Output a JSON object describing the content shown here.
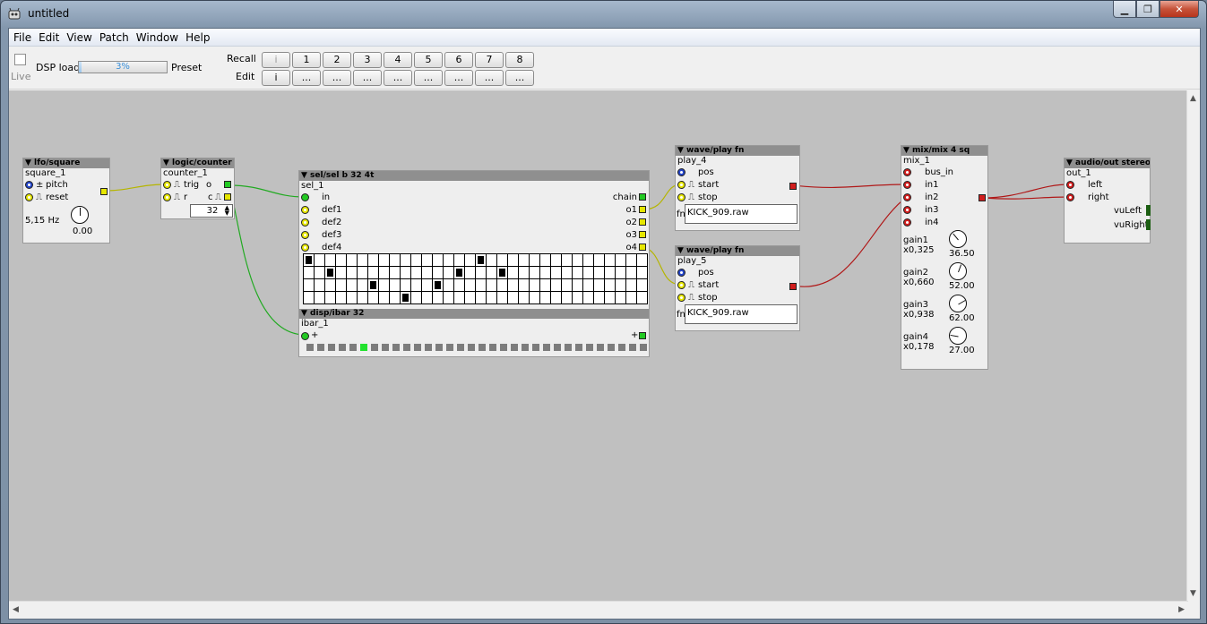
{
  "window": {
    "title": "untitled",
    "controls": {
      "minimize": "▁",
      "maximize": "❐",
      "close": "✕"
    }
  },
  "menu": {
    "items": [
      {
        "label": "File"
      },
      {
        "label": "Edit"
      },
      {
        "label": "View"
      },
      {
        "label": "Patch"
      },
      {
        "label": "Window"
      },
      {
        "label": "Help"
      }
    ]
  },
  "toolbar": {
    "live_label": "Live",
    "live_checked": false,
    "dsp_label": "DSP load",
    "dsp_value": "3%",
    "dsp_fraction": 0.03,
    "preset_label": "Preset",
    "recall_label": "Recall",
    "edit_label": "Edit",
    "recall_buttons": [
      "i",
      "1",
      "2",
      "3",
      "4",
      "5",
      "6",
      "7",
      "8"
    ],
    "edit_buttons": [
      "i",
      "...",
      "...",
      "...",
      "...",
      "...",
      "...",
      "...",
      "..."
    ]
  },
  "patch": {
    "lfo": {
      "header": "▼ lfo/square",
      "name": "square_1",
      "inlets": [
        "pitch",
        "reset"
      ],
      "pitch_prefix": "±",
      "freq": "5,15 Hz",
      "knob_value": "0.00"
    },
    "counter": {
      "header": "▼ logic/counter",
      "name": "counter_1",
      "inlets": [
        "trig",
        "r"
      ],
      "outlets": [
        "o",
        "c"
      ],
      "value": "32"
    },
    "sel": {
      "header": "▼ sel/sel b 32 4t",
      "name": "sel_1",
      "inlets": [
        "in",
        "def1",
        "def2",
        "def3",
        "def4"
      ],
      "outlets": [
        "chain",
        "o1",
        "o2",
        "o3",
        "o4"
      ],
      "steps": [
        [
          0,
          16
        ],
        [
          2,
          14,
          18
        ],
        [
          6,
          12
        ],
        [
          9
        ]
      ]
    },
    "ibar": {
      "header": "▼ disp/ibar 32",
      "name": "ibar_1",
      "plus_left": "+",
      "plus_right": "+",
      "segments": 32,
      "active_segment": 5
    },
    "play4": {
      "header": "▼ wave/play fn",
      "name": "play_4",
      "inlets": [
        "pos",
        "start",
        "stop"
      ],
      "fn_label": "fn",
      "file": "KICK_909.raw"
    },
    "play5": {
      "header": "▼ wave/play fn",
      "name": "play_5",
      "inlets": [
        "pos",
        "start",
        "stop"
      ],
      "fn_label": "fn",
      "file": "KICK_909.raw"
    },
    "mix": {
      "header": "▼ mix/mix 4 sq",
      "name": "mix_1",
      "inlets": [
        "bus_in",
        "in1",
        "in2",
        "in3",
        "in4"
      ],
      "gains": [
        {
          "label": "gain1",
          "mult": "x0,325",
          "value": "36.50"
        },
        {
          "label": "gain2",
          "mult": "x0,660",
          "value": "52.00"
        },
        {
          "label": "gain3",
          "mult": "x0,938",
          "value": "62.00"
        },
        {
          "label": "gain4",
          "mult": "x0,178",
          "value": "27.00"
        }
      ]
    },
    "out": {
      "header": "▼ audio/out stereo",
      "name": "out_1",
      "inlets": [
        "left",
        "right"
      ],
      "vu": [
        "vuLeft",
        "vuRight"
      ]
    }
  },
  "colors": {
    "canvas": "#c0c0c0",
    "wire_bool": "#b5b500",
    "wire_int": "#22aa22",
    "wire_audio": "#b01818"
  }
}
